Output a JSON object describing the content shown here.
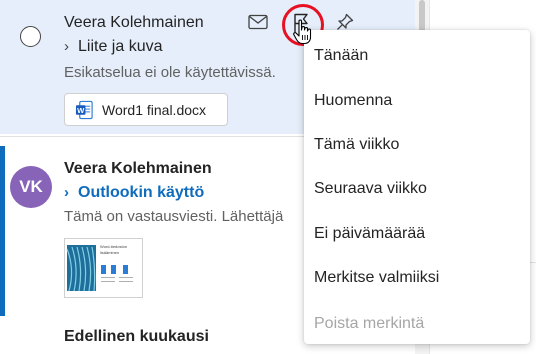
{
  "messages": [
    {
      "sender": "Veera Kolehmainen",
      "subject": "Liite ja kuva",
      "preview": "Esikatselua ei ole käytettävissä.",
      "attachment": "Word1 final.docx"
    },
    {
      "avatar_initials": "VK",
      "sender": "Veera Kolehmainen",
      "subject": "Outlookin käyttö",
      "preview": "Tämä on vastausviesti. Lähettäjä"
    }
  ],
  "section_header": "Edellinen kuukausi",
  "thumbnail": {
    "title_line1": "Word-tiedoston",
    "title_line2": "lisääminen"
  },
  "flag_menu": {
    "items": [
      {
        "label": "Tänään",
        "enabled": true
      },
      {
        "label": "Huomenna",
        "enabled": true
      },
      {
        "label": "Tämä viikko",
        "enabled": true
      },
      {
        "label": "Seuraava viikko",
        "enabled": true
      },
      {
        "label": "Ei päivämäärää",
        "enabled": true
      },
      {
        "label": "Merkitse valmiiksi",
        "enabled": true
      },
      {
        "label": "Poista merkintä",
        "enabled": false
      }
    ]
  },
  "icons": {
    "mail": "envelope-icon",
    "flag": "flag-icon",
    "pin": "pin-icon",
    "cursor": "hand-pointer-icon",
    "word": "word-file-icon"
  },
  "colors": {
    "selected_bg": "#e5eefa",
    "accent": "#0f6cbd",
    "avatar": "#8764b8",
    "highlight_ring": "#e81123"
  }
}
